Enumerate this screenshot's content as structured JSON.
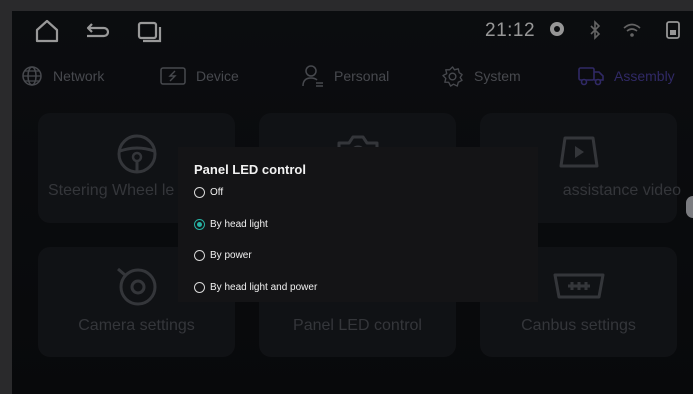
{
  "status_bar": {
    "time": "21:12",
    "icons": [
      "home-icon",
      "back-icon",
      "recent-apps-icon",
      "location-icon",
      "bluetooth-icon",
      "wifi-icon",
      "sim-icon"
    ]
  },
  "tabs": [
    {
      "label": "Network",
      "icon": "globe-icon",
      "active": false
    },
    {
      "label": "Device",
      "icon": "device-icon",
      "active": false
    },
    {
      "label": "Personal",
      "icon": "person-icon",
      "active": false
    },
    {
      "label": "System",
      "icon": "gear-icon",
      "active": false
    },
    {
      "label": "Assembly",
      "icon": "truck-icon",
      "active": true
    }
  ],
  "cards": [
    {
      "label": "Steering Wheel le",
      "icon": "steering-wheel-icon"
    },
    {
      "label": "",
      "icon": "camera-icon"
    },
    {
      "label": "assistance video",
      "icon": "video-icon"
    },
    {
      "label": "Camera settings",
      "icon": "camera-settings-icon"
    },
    {
      "label": "Panel LED control",
      "icon": ""
    },
    {
      "label": "Canbus settings",
      "icon": "canbus-icon"
    }
  ],
  "dialog": {
    "title": "Panel LED control",
    "options": [
      {
        "label": "Off",
        "checked": false
      },
      {
        "label": "By head light",
        "checked": true
      },
      {
        "label": "By power",
        "checked": false
      },
      {
        "label": "By head light and power",
        "checked": false
      }
    ]
  },
  "colors": {
    "accent": "#27b3a4",
    "active_tab": "#4a3f9c"
  }
}
